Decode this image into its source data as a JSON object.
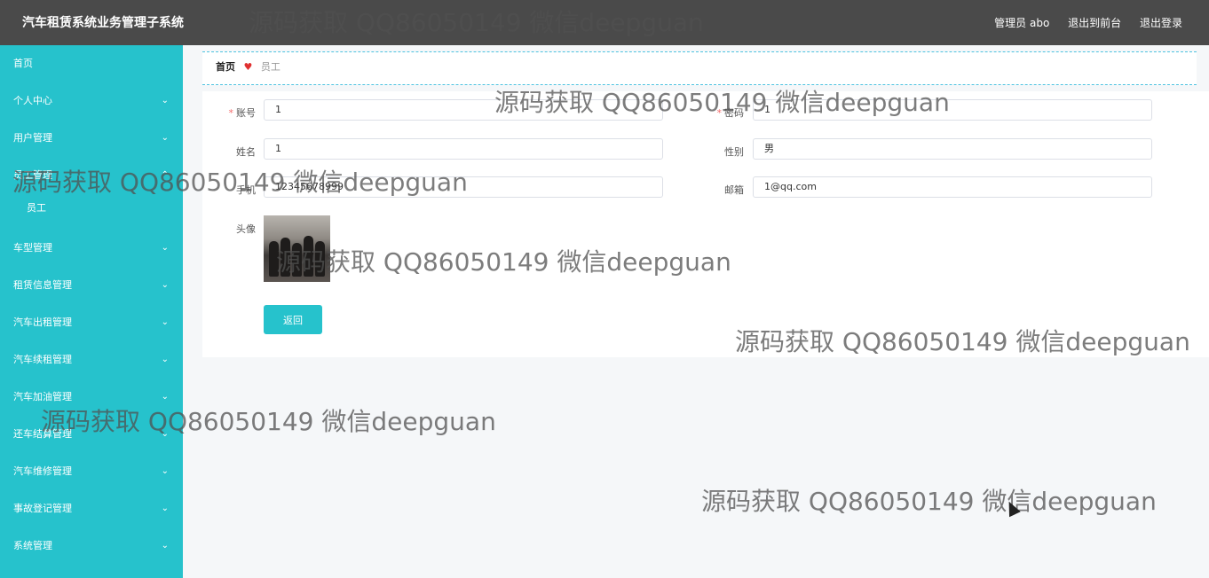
{
  "header": {
    "title": "汽车租赁系统业务管理子系统",
    "user_label": "管理员 abo",
    "front_label": "退出到前台",
    "logout_label": "退出登录"
  },
  "sidebar": {
    "items": [
      {
        "label": "首页"
      },
      {
        "label": "个人中心"
      },
      {
        "label": "用户管理"
      },
      {
        "label": "员工管理"
      },
      {
        "label": "车型管理"
      },
      {
        "label": "租赁信息管理"
      },
      {
        "label": "汽车出租管理"
      },
      {
        "label": "汽车续租管理"
      },
      {
        "label": "汽车加油管理"
      },
      {
        "label": "还车结算管理"
      },
      {
        "label": "汽车维修管理"
      },
      {
        "label": "事故登记管理"
      },
      {
        "label": "系统管理"
      }
    ],
    "sub_item": "员工"
  },
  "breadcrumb": {
    "home": "首页",
    "separator": "♥",
    "current": "员工"
  },
  "form": {
    "account_label": "账号",
    "account_value": "1",
    "password_label": "密码",
    "password_value": "1",
    "name_label": "姓名",
    "name_value": "1",
    "gender_label": "性别",
    "gender_value": "男",
    "phone_label": "手机",
    "phone_value": "12345678999",
    "email_label": "邮箱",
    "email_value": "1@qq.com",
    "avatar_label": "头像",
    "back_label": "返回"
  },
  "watermark": "源码获取 QQ86050149 微信deepguan",
  "colors": {
    "header_bg": "#4a4a4a",
    "sidebar_bg": "#26c2cc",
    "accent": "#26c2cc",
    "required": "#f56c6c"
  }
}
